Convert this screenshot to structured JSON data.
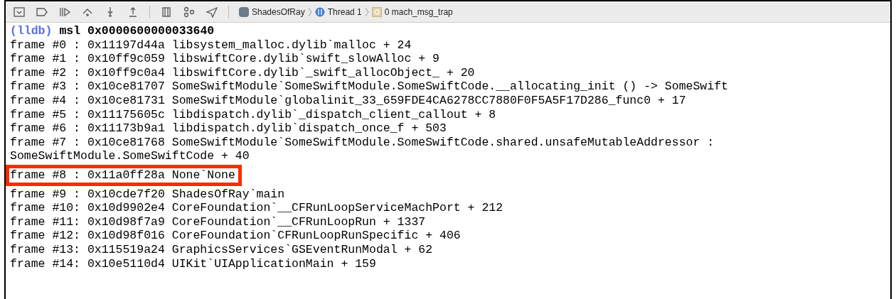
{
  "breadcrumb": [
    {
      "kind": "app",
      "label": "ShadesOfRay"
    },
    {
      "kind": "thread",
      "label": "Thread 1"
    },
    {
      "kind": "frame",
      "label": "0 mach_msg_trap"
    }
  ],
  "console": {
    "prompt": "(lldb)",
    "command": "msl 0x0000600000033640",
    "lines": [
      {
        "text": "frame #0 : 0x11197d44a libsystem_malloc.dylib`malloc + 24",
        "highlighted": false
      },
      {
        "text": "frame #1 : 0x10ff9c059 libswiftCore.dylib`swift_slowAlloc + 9",
        "highlighted": false
      },
      {
        "text": "frame #2 : 0x10ff9c0a4 libswiftCore.dylib`_swift_allocObject_ + 20",
        "highlighted": false
      },
      {
        "text": "frame #3 : 0x10ce81707 SomeSwiftModule`SomeSwiftModule.SomeSwiftCode.__allocating_init () -> SomeSwift",
        "highlighted": false
      },
      {
        "text": "frame #4 : 0x10ce81731 SomeSwiftModule`globalinit_33_659FDE4CA6278CC7880F0F5A5F17D286_func0 + 17",
        "highlighted": false
      },
      {
        "text": "frame #5 : 0x11175605c libdispatch.dylib`_dispatch_client_callout + 8",
        "highlighted": false
      },
      {
        "text": "frame #6 : 0x11173b9a1 libdispatch.dylib`dispatch_once_f + 503",
        "highlighted": false
      },
      {
        "text": "frame #7 : 0x10ce81768 SomeSwiftModule`SomeSwiftModule.SomeSwiftCode.shared.unsafeMutableAddressor :",
        "highlighted": false
      },
      {
        "text": "SomeSwiftModule.SomeSwiftCode + 40",
        "highlighted": false
      },
      {
        "text": "frame #8 : 0x11a0ff28a None`None",
        "highlighted": true
      },
      {
        "text": "frame #9 : 0x10cde7f20 ShadesOfRay`main",
        "highlighted": false
      },
      {
        "text": "frame #10: 0x10d9902e4 CoreFoundation`__CFRunLoopServiceMachPort + 212",
        "highlighted": false
      },
      {
        "text": "frame #11: 0x10d98f7a9 CoreFoundation`__CFRunLoopRun + 1337",
        "highlighted": false
      },
      {
        "text": "frame #12: 0x10d98f016 CoreFoundation`CFRunLoopRunSpecific + 406",
        "highlighted": false
      },
      {
        "text": "frame #13: 0x115519a24 GraphicsServices`GSEventRunModal + 62",
        "highlighted": false
      },
      {
        "text": "frame #14: 0x10e5110d4 UIKit`UIApplicationMain + 159",
        "highlighted": false
      }
    ]
  }
}
